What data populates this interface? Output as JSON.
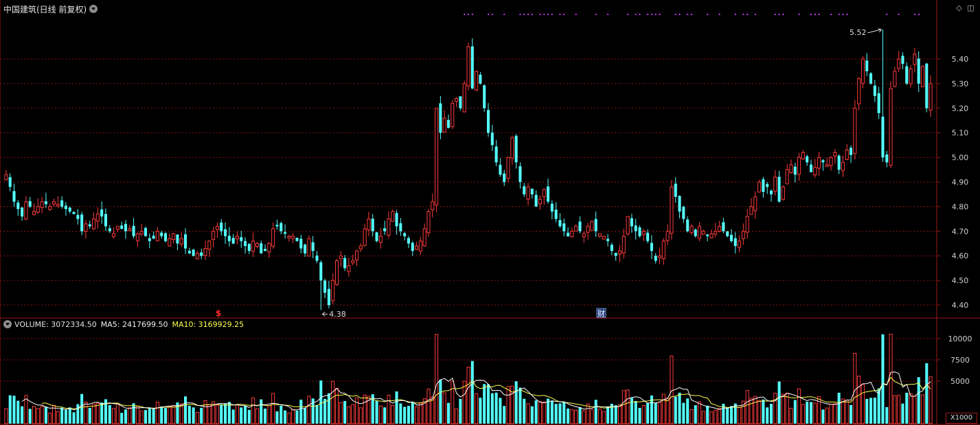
{
  "header": {
    "stock_title": "中国建筑(日线 前复权)"
  },
  "volume_header": {
    "volume_text": "VOLUME: 3072334.50",
    "ma5_text": "MA5: 2417699.50",
    "ma10_text": "MA10: 3169929.25"
  },
  "markers": {
    "dividend_marker": "$",
    "finance_marker": "财",
    "low_label": "4.38",
    "high_label": "5.52"
  },
  "volume_unit": "X1000",
  "colors": {
    "up": "#ff3b3b",
    "down": "#54ffff",
    "ma5": "#ffffff",
    "ma10": "#ffff4d",
    "grid": "#8a1414",
    "axis_text": "#d0d0d0",
    "signal_dots": "#cc33ff"
  },
  "chart_data": [
    {
      "type": "candlestick",
      "title": "中国建筑(日线 前复权)",
      "ylim": [
        4.35,
        5.57
      ],
      "y_ticks": [
        4.4,
        4.5,
        4.6,
        4.7,
        4.8,
        4.9,
        5.0,
        5.1,
        5.2,
        5.3,
        5.4
      ],
      "annotations": [
        {
          "label": "4.38",
          "kind": "period-low",
          "index": 79
        },
        {
          "label": "5.52",
          "kind": "period-high",
          "index": 220
        }
      ],
      "close": [
        4.93,
        4.88,
        4.82,
        4.79,
        4.76,
        4.82,
        4.8,
        4.78,
        4.8,
        4.82,
        4.81,
        4.8,
        4.82,
        4.81,
        4.8,
        4.79,
        4.78,
        4.77,
        4.75,
        4.7,
        4.73,
        4.72,
        4.75,
        4.77,
        4.76,
        4.72,
        4.7,
        4.69,
        4.72,
        4.71,
        4.7,
        4.71,
        4.68,
        4.69,
        4.7,
        4.68,
        4.66,
        4.67,
        4.7,
        4.68,
        4.66,
        4.67,
        4.69,
        4.65,
        4.67,
        4.63,
        4.61,
        4.6,
        4.61,
        4.6,
        4.63,
        4.66,
        4.7,
        4.72,
        4.7,
        4.68,
        4.66,
        4.65,
        4.68,
        4.66,
        4.64,
        4.62,
        4.66,
        4.65,
        4.61,
        4.62,
        4.65,
        4.71,
        4.72,
        4.7,
        4.69,
        4.68,
        4.68,
        4.66,
        4.63,
        4.61,
        4.67,
        4.62,
        4.58,
        4.5,
        4.45,
        4.4,
        4.5,
        4.58,
        4.6,
        4.55,
        4.56,
        4.58,
        4.62,
        4.64,
        4.71,
        4.75,
        4.7,
        4.66,
        4.68,
        4.7,
        4.75,
        4.78,
        4.72,
        4.7,
        4.68,
        4.65,
        4.62,
        4.64,
        4.66,
        4.71,
        4.78,
        4.82,
        5.2,
        5.1,
        5.16,
        5.12,
        5.22,
        5.24,
        5.2,
        5.3,
        5.45,
        5.28,
        5.35,
        5.3,
        5.2,
        5.1,
        5.05,
        4.98,
        4.93,
        4.9,
        5.0,
        5.08,
        4.98,
        4.9,
        4.85,
        4.88,
        4.85,
        4.8,
        4.83,
        4.87,
        4.82,
        4.78,
        4.75,
        4.72,
        4.7,
        4.68,
        4.7,
        4.72,
        4.7,
        4.69,
        4.72,
        4.74,
        4.7,
        4.69,
        4.68,
        4.66,
        4.62,
        4.6,
        4.62,
        4.68,
        4.76,
        4.72,
        4.7,
        4.68,
        4.7,
        4.66,
        4.62,
        4.58,
        4.6,
        4.66,
        4.7,
        4.88,
        4.84,
        4.78,
        4.75,
        4.7,
        4.72,
        4.68,
        4.72,
        4.7,
        4.68,
        4.69,
        4.7,
        4.72,
        4.7,
        4.68,
        4.66,
        4.64,
        4.66,
        4.7,
        4.76,
        4.8,
        4.84,
        4.9,
        4.86,
        4.88,
        4.85,
        4.92,
        4.82,
        4.88,
        4.95,
        4.97,
        4.93,
        5.0,
        5.02,
        4.98,
        4.94,
        4.96,
        5.0,
        4.98,
        4.97,
        5.0,
        5.02,
        4.95,
        4.98,
        5.03,
        5.01,
        5.2,
        5.32,
        5.4,
        5.35,
        5.3,
        5.25,
        5.18,
        5.0,
        4.98,
        5.28,
        5.35,
        5.4,
        5.38,
        5.3,
        5.36,
        5.42,
        5.3,
        5.37,
        5.2,
        5.3
      ],
      "volume_unit": "X1000",
      "volume_ticks": [
        5000,
        7500,
        10000
      ],
      "volume_ylim": [
        0,
        10800
      ],
      "series": [
        {
          "name": "MA5",
          "type": "line"
        },
        {
          "name": "MA10",
          "type": "line"
        }
      ]
    }
  ]
}
